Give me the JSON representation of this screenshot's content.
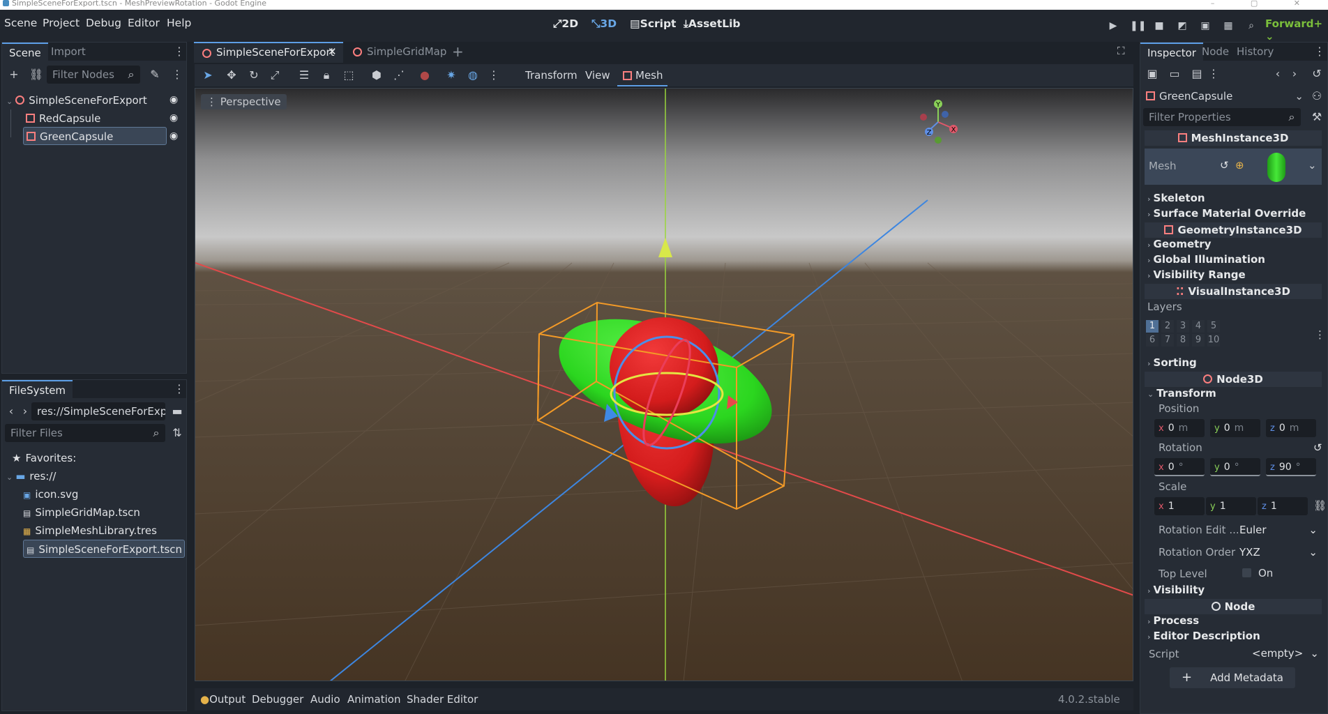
{
  "window": {
    "title": "SimpleSceneForExport.tscn - MeshPreviewRotation - Godot Engine"
  },
  "menubar": {
    "items": [
      "Scene",
      "Project",
      "Debug",
      "Editor",
      "Help"
    ]
  },
  "modes": {
    "2d": "2D",
    "3d": "3D",
    "script": "Script",
    "assetlib": "AssetLib"
  },
  "renderer": "Forward+",
  "scene_dock": {
    "tabs": [
      "Scene",
      "Import"
    ],
    "filter_placeholder": "Filter Nodes",
    "nodes": [
      {
        "name": "SimpleSceneForExport",
        "type": "Node3D"
      },
      {
        "name": "RedCapsule",
        "type": "MeshInstance3D"
      },
      {
        "name": "GreenCapsule",
        "type": "MeshInstance3D",
        "selected": true
      }
    ]
  },
  "filesystem": {
    "tab": "FileSystem",
    "path": "res://SimpleSceneForExpor",
    "filter_placeholder": "Filter Files",
    "favorites_label": "Favorites:",
    "root": "res://",
    "files": [
      "icon.svg",
      "SimpleGridMap.tscn",
      "SimpleMeshLibrary.tres",
      "SimpleSceneForExport.tscn"
    ],
    "selected_file": "SimpleSceneForExport.tscn"
  },
  "editor_tabs": {
    "active": "SimpleSceneForExport",
    "other": "SimpleGridMap"
  },
  "viewport_toolbar": {
    "transform": "Transform",
    "view": "View",
    "mesh": "Mesh"
  },
  "viewport": {
    "perspective": "Perspective",
    "gizmo": {
      "x": "X",
      "y": "Y",
      "z": "Z"
    }
  },
  "inspector": {
    "tabs": [
      "Inspector",
      "Node",
      "History"
    ],
    "object": "GreenCapsule",
    "filter_placeholder": "Filter Properties",
    "class_mesh_instance": "MeshInstance3D",
    "mesh_label": "Mesh",
    "skeleton": "Skeleton",
    "surface_override": "Surface Material Override",
    "class_geometry": "GeometryInstance3D",
    "geometry": "Geometry",
    "global_illumination": "Global Illumination",
    "visibility_range": "Visibility Range",
    "class_visual": "VisualInstance3D",
    "layers_label": "Layers",
    "layers": [
      "1",
      "2",
      "3",
      "4",
      "5",
      "6",
      "7",
      "8",
      "9",
      "10"
    ],
    "sorting": "Sorting",
    "class_node3d": "Node3D",
    "transform": "Transform",
    "position_label": "Position",
    "position": {
      "x": "0",
      "y": "0",
      "z": "0",
      "unit": "m"
    },
    "rotation_label": "Rotation",
    "rotation": {
      "x": "0",
      "y": "0",
      "z": "90",
      "unit": "°"
    },
    "scale_label": "Scale",
    "scale": {
      "x": "1",
      "y": "1",
      "z": "1"
    },
    "rotation_edit_label": "Rotation Edit ...",
    "rotation_edit_value": "Euler",
    "rotation_order_label": "Rotation Order",
    "rotation_order_value": "YXZ",
    "top_level_label": "Top Level",
    "top_level_value": "On",
    "visibility": "Visibility",
    "class_node": "Node",
    "process": "Process",
    "editor_description": "Editor Description",
    "script_label": "Script",
    "script_value": "<empty>",
    "add_metadata": "Add Metadata"
  },
  "bottom_panel": {
    "tabs": [
      "Output",
      "Debugger",
      "Audio",
      "Animation",
      "Shader Editor"
    ],
    "version": "4.0.2.stable"
  },
  "colors": {
    "accent": "#69a7e6",
    "node_red": "#fc7f7f",
    "renderer_green": "#7bbf3b",
    "x_axis": "#e0586a",
    "y_axis": "#8ad058",
    "z_axis": "#5f8fe6"
  }
}
